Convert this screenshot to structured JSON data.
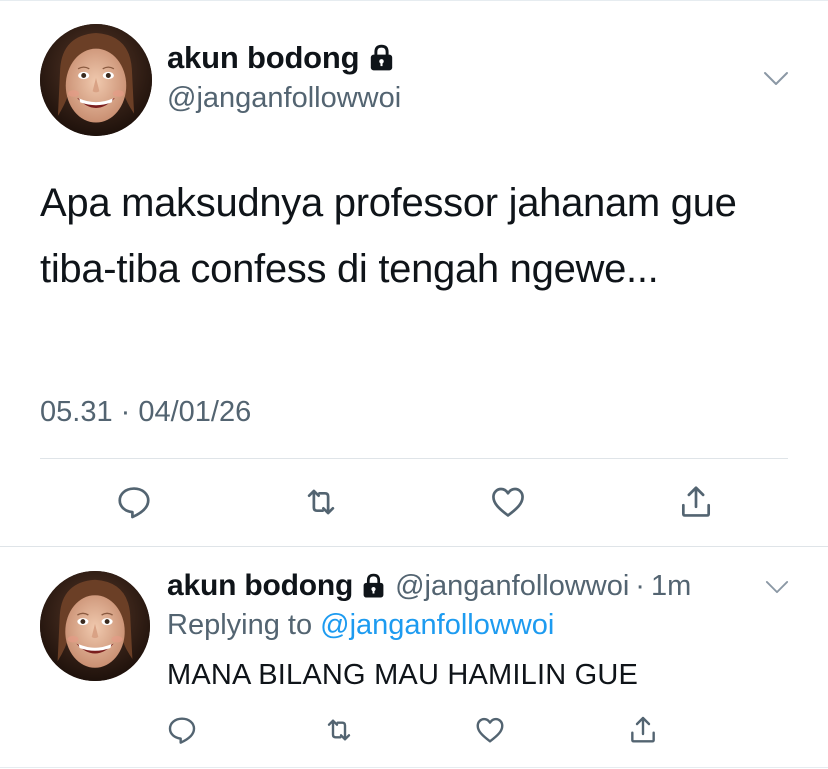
{
  "main_tweet": {
    "display_name": "akun bodong",
    "handle": "@janganfollowwoi",
    "text": "Apa maksudnya professor jahanam gue tiba-tiba confess di tengah ngewe...",
    "timestamp": "05.31 · 04/01/26",
    "icons": [
      "lock-icon",
      "chevron-down-icon",
      "reply-icon",
      "retweet-icon",
      "like-icon",
      "share-icon"
    ]
  },
  "reply_tweet": {
    "display_name": "akun bodong",
    "handle": "@janganfollowwoi",
    "separator": "·",
    "time": "1m",
    "replying_prefix": "Replying to",
    "replying_to": "@janganfollowwoi",
    "text": "MANA BILANG MAU HAMILIN GUE",
    "icons": [
      "lock-icon",
      "chevron-down-icon",
      "reply-icon",
      "retweet-icon",
      "like-icon",
      "share-icon"
    ]
  },
  "colors": {
    "text_primary": "#0f1419",
    "text_secondary": "#536471",
    "link": "#1d9bf0",
    "divider": "#dfe4e8",
    "background": "#ffffff"
  }
}
